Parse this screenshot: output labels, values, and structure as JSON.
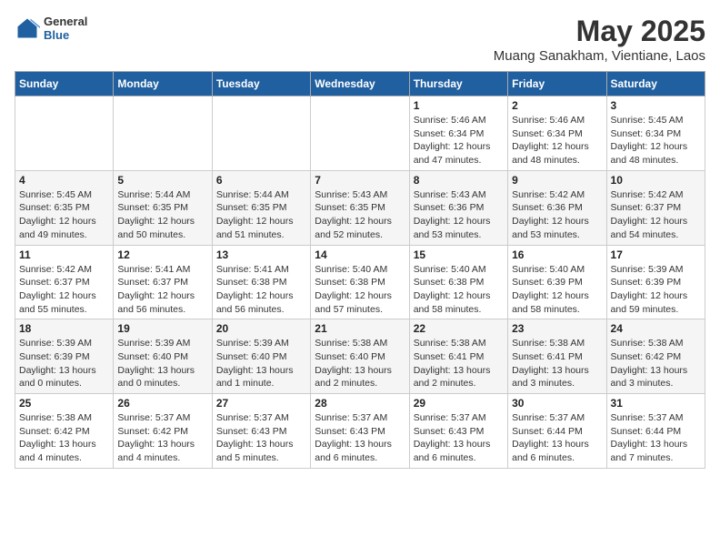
{
  "header": {
    "logo_general": "General",
    "logo_blue": "Blue",
    "month_title": "May 2025",
    "location": "Muang Sanakham, Vientiane, Laos"
  },
  "weekdays": [
    "Sunday",
    "Monday",
    "Tuesday",
    "Wednesday",
    "Thursday",
    "Friday",
    "Saturday"
  ],
  "weeks": [
    [
      {
        "day": "",
        "info": ""
      },
      {
        "day": "",
        "info": ""
      },
      {
        "day": "",
        "info": ""
      },
      {
        "day": "",
        "info": ""
      },
      {
        "day": "1",
        "info": "Sunrise: 5:46 AM\nSunset: 6:34 PM\nDaylight: 12 hours\nand 47 minutes."
      },
      {
        "day": "2",
        "info": "Sunrise: 5:46 AM\nSunset: 6:34 PM\nDaylight: 12 hours\nand 48 minutes."
      },
      {
        "day": "3",
        "info": "Sunrise: 5:45 AM\nSunset: 6:34 PM\nDaylight: 12 hours\nand 48 minutes."
      }
    ],
    [
      {
        "day": "4",
        "info": "Sunrise: 5:45 AM\nSunset: 6:35 PM\nDaylight: 12 hours\nand 49 minutes."
      },
      {
        "day": "5",
        "info": "Sunrise: 5:44 AM\nSunset: 6:35 PM\nDaylight: 12 hours\nand 50 minutes."
      },
      {
        "day": "6",
        "info": "Sunrise: 5:44 AM\nSunset: 6:35 PM\nDaylight: 12 hours\nand 51 minutes."
      },
      {
        "day": "7",
        "info": "Sunrise: 5:43 AM\nSunset: 6:35 PM\nDaylight: 12 hours\nand 52 minutes."
      },
      {
        "day": "8",
        "info": "Sunrise: 5:43 AM\nSunset: 6:36 PM\nDaylight: 12 hours\nand 53 minutes."
      },
      {
        "day": "9",
        "info": "Sunrise: 5:42 AM\nSunset: 6:36 PM\nDaylight: 12 hours\nand 53 minutes."
      },
      {
        "day": "10",
        "info": "Sunrise: 5:42 AM\nSunset: 6:37 PM\nDaylight: 12 hours\nand 54 minutes."
      }
    ],
    [
      {
        "day": "11",
        "info": "Sunrise: 5:42 AM\nSunset: 6:37 PM\nDaylight: 12 hours\nand 55 minutes."
      },
      {
        "day": "12",
        "info": "Sunrise: 5:41 AM\nSunset: 6:37 PM\nDaylight: 12 hours\nand 56 minutes."
      },
      {
        "day": "13",
        "info": "Sunrise: 5:41 AM\nSunset: 6:38 PM\nDaylight: 12 hours\nand 56 minutes."
      },
      {
        "day": "14",
        "info": "Sunrise: 5:40 AM\nSunset: 6:38 PM\nDaylight: 12 hours\nand 57 minutes."
      },
      {
        "day": "15",
        "info": "Sunrise: 5:40 AM\nSunset: 6:38 PM\nDaylight: 12 hours\nand 58 minutes."
      },
      {
        "day": "16",
        "info": "Sunrise: 5:40 AM\nSunset: 6:39 PM\nDaylight: 12 hours\nand 58 minutes."
      },
      {
        "day": "17",
        "info": "Sunrise: 5:39 AM\nSunset: 6:39 PM\nDaylight: 12 hours\nand 59 minutes."
      }
    ],
    [
      {
        "day": "18",
        "info": "Sunrise: 5:39 AM\nSunset: 6:39 PM\nDaylight: 13 hours\nand 0 minutes."
      },
      {
        "day": "19",
        "info": "Sunrise: 5:39 AM\nSunset: 6:40 PM\nDaylight: 13 hours\nand 0 minutes."
      },
      {
        "day": "20",
        "info": "Sunrise: 5:39 AM\nSunset: 6:40 PM\nDaylight: 13 hours\nand 1 minute."
      },
      {
        "day": "21",
        "info": "Sunrise: 5:38 AM\nSunset: 6:40 PM\nDaylight: 13 hours\nand 2 minutes."
      },
      {
        "day": "22",
        "info": "Sunrise: 5:38 AM\nSunset: 6:41 PM\nDaylight: 13 hours\nand 2 minutes."
      },
      {
        "day": "23",
        "info": "Sunrise: 5:38 AM\nSunset: 6:41 PM\nDaylight: 13 hours\nand 3 minutes."
      },
      {
        "day": "24",
        "info": "Sunrise: 5:38 AM\nSunset: 6:42 PM\nDaylight: 13 hours\nand 3 minutes."
      }
    ],
    [
      {
        "day": "25",
        "info": "Sunrise: 5:38 AM\nSunset: 6:42 PM\nDaylight: 13 hours\nand 4 minutes."
      },
      {
        "day": "26",
        "info": "Sunrise: 5:37 AM\nSunset: 6:42 PM\nDaylight: 13 hours\nand 4 minutes."
      },
      {
        "day": "27",
        "info": "Sunrise: 5:37 AM\nSunset: 6:43 PM\nDaylight: 13 hours\nand 5 minutes."
      },
      {
        "day": "28",
        "info": "Sunrise: 5:37 AM\nSunset: 6:43 PM\nDaylight: 13 hours\nand 6 minutes."
      },
      {
        "day": "29",
        "info": "Sunrise: 5:37 AM\nSunset: 6:43 PM\nDaylight: 13 hours\nand 6 minutes."
      },
      {
        "day": "30",
        "info": "Sunrise: 5:37 AM\nSunset: 6:44 PM\nDaylight: 13 hours\nand 6 minutes."
      },
      {
        "day": "31",
        "info": "Sunrise: 5:37 AM\nSunset: 6:44 PM\nDaylight: 13 hours\nand 7 minutes."
      }
    ]
  ]
}
